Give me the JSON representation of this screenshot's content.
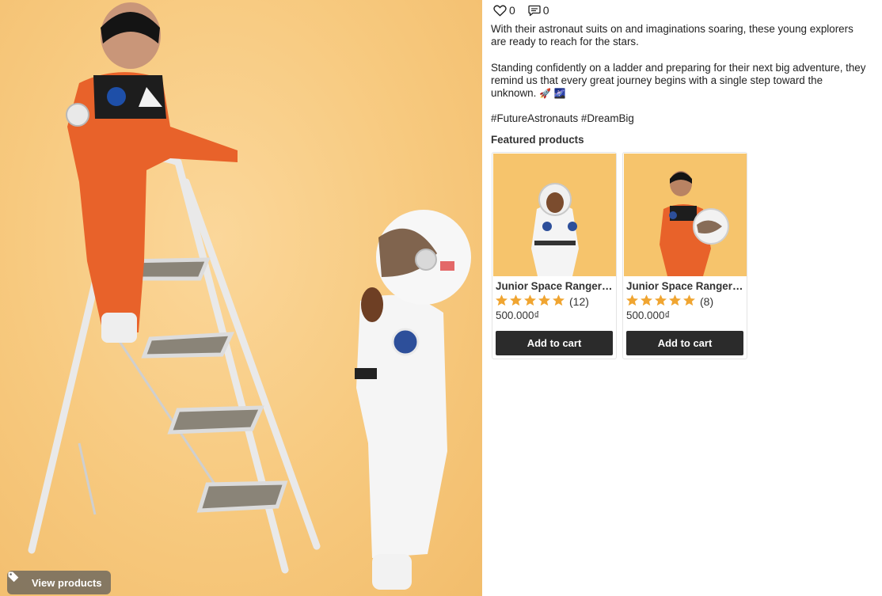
{
  "post": {
    "image_alt_name": "astronaut-kids-photo",
    "view_products_label": "View products",
    "likes": "0",
    "comments": "0",
    "caption_p1": "With their astronaut suits on and imaginations soaring, these young explorers are ready to reach for the stars.",
    "caption_p2": "Standing confidently on a ladder and preparing for their next big adventure, they remind us that every great journey begins with a single step toward the unknown.",
    "caption_emoji": "🚀 🌌",
    "hashtags": "#FutureAstronauts #DreamBig"
  },
  "featured": {
    "title": "Featured products",
    "products": [
      {
        "name": "Junior Space Ranger Astronaut Costume",
        "rating": 5,
        "reviews": "(12)",
        "price": "500.000₫",
        "button": "Add to cart",
        "suit_color": "#f4f4f4"
      },
      {
        "name": "Junior Space Ranger Astronaut Costume",
        "rating": 5,
        "reviews": "(8)",
        "price": "500.000₫",
        "button": "Add to cart",
        "suit_color": "#e8622a"
      }
    ]
  },
  "colors": {
    "accent_star": "#f0a531",
    "button_bg": "#2b2b2b",
    "photo_bg": "#f7c97e"
  },
  "icons": {
    "like": "heart-icon",
    "comment": "comment-icon",
    "tag": "tag-icon",
    "star": "star-icon"
  }
}
